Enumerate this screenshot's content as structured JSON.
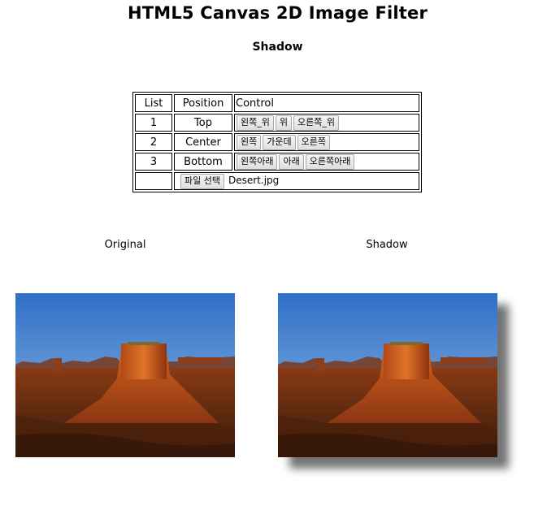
{
  "page": {
    "title": "HTML5 Canvas 2D Image Filter",
    "subtitle": "Shadow"
  },
  "table": {
    "headers": {
      "list": "List",
      "position": "Position",
      "control": "Control"
    },
    "rows": [
      {
        "list": "1",
        "position": "Top",
        "buttons": [
          "왼쪽_위",
          "위",
          "오른쪽_위"
        ]
      },
      {
        "list": "2",
        "position": "Center",
        "buttons": [
          "왼쪽",
          "가운데",
          "오른쪽"
        ]
      },
      {
        "list": "3",
        "position": "Bottom",
        "buttons": [
          "왼쪽아래",
          "아래",
          "오른쪽아래"
        ]
      }
    ],
    "file": {
      "button_label": "파일 선택",
      "file_name": "Desert.jpg"
    }
  },
  "canvases": {
    "original_label": "Original",
    "shadow_label": "Shadow"
  }
}
